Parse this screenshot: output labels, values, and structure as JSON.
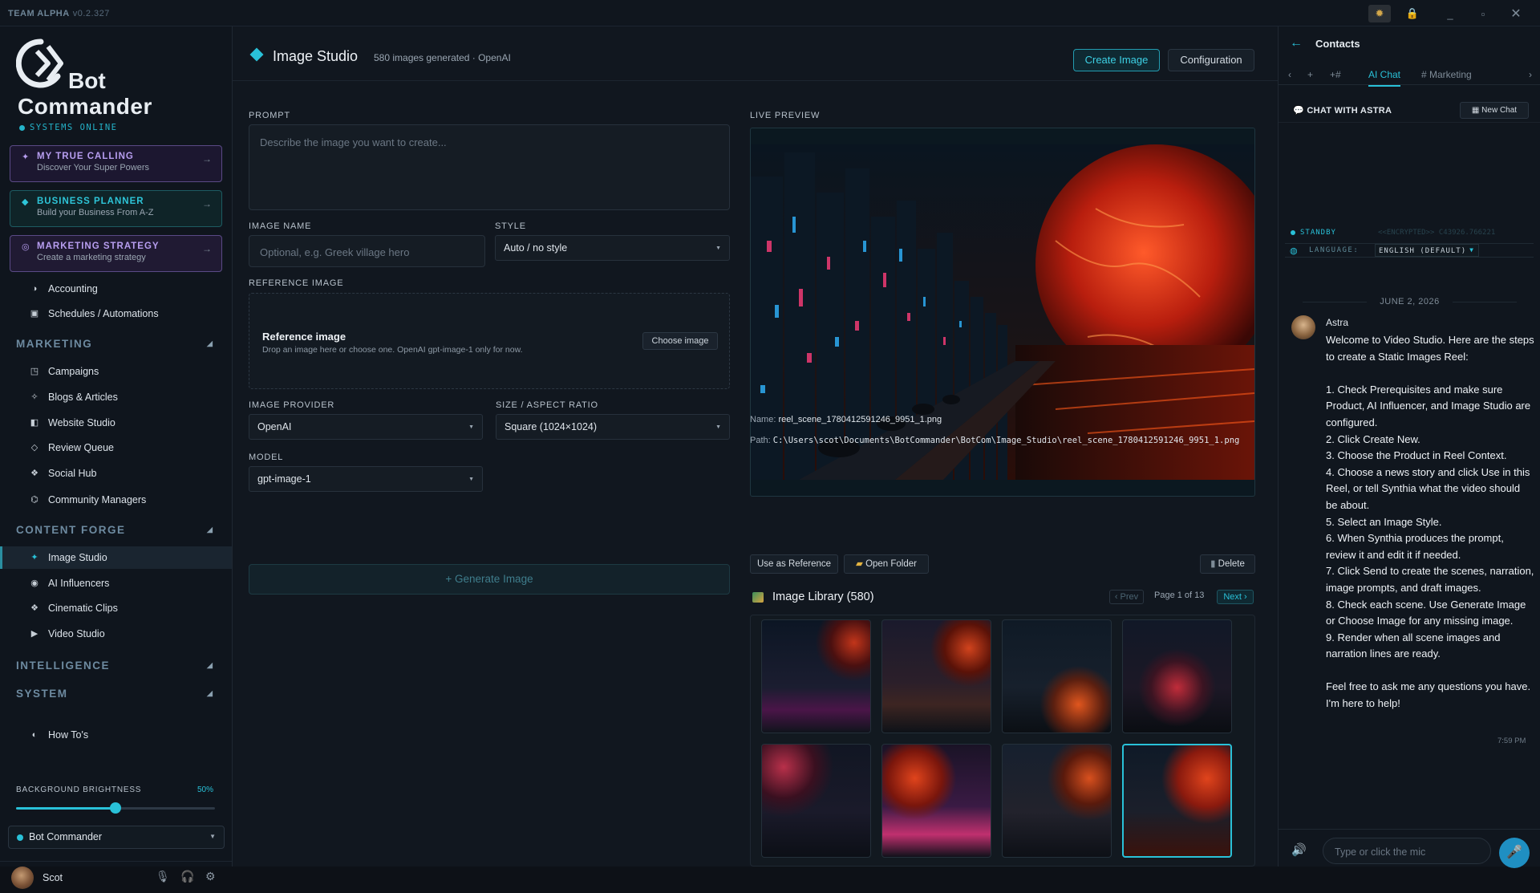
{
  "titlebar": {
    "app": "TEAM ALPHA",
    "version": "v0.2.327"
  },
  "brand": {
    "line1": "Bot",
    "line2": "Commander",
    "status": "SYSTEMS ONLINE"
  },
  "featured": [
    {
      "title": "MY TRUE CALLING",
      "subtitle": "Discover Your Super Powers",
      "icon": "sparkle-icon"
    },
    {
      "title": "BUSINESS PLANNER",
      "subtitle": "Build your Business From A-Z",
      "icon": "diamond-icon"
    },
    {
      "title": "MARKETING STRATEGY",
      "subtitle": "Create a marketing strategy",
      "icon": "target-icon"
    }
  ],
  "nav_top": [
    {
      "label": "Accounting"
    },
    {
      "label": "Schedules / Automations"
    }
  ],
  "sections": {
    "marketing": "MARKETING",
    "content_forge": "CONTENT FORGE",
    "intelligence": "INTELLIGENCE",
    "system": "SYSTEM"
  },
  "nav_marketing": [
    {
      "label": "Campaigns"
    },
    {
      "label": "Blogs & Articles"
    },
    {
      "label": "Website Studio"
    },
    {
      "label": "Review Queue"
    },
    {
      "label": "Social Hub"
    },
    {
      "label": "Community Managers"
    }
  ],
  "nav_content": [
    {
      "label": "Image Studio"
    },
    {
      "label": "AI Influencers"
    },
    {
      "label": "Cinematic Clips"
    },
    {
      "label": "Video Studio"
    }
  ],
  "nav_bottom": {
    "howtos": "How To's"
  },
  "brightness": {
    "label": "BACKGROUND BRIGHTNESS",
    "value": "50%",
    "fraction": 0.5
  },
  "agent": "Bot Commander",
  "user": {
    "name": "Scot"
  },
  "header": {
    "title": "Image Studio",
    "subtitle": "580 images generated · OpenAI",
    "create": "Create Image",
    "config": "Configuration"
  },
  "form": {
    "prompt_label": "PROMPT",
    "prompt_placeholder": "Describe the image you want to create...",
    "name_label": "IMAGE NAME",
    "name_placeholder": "Optional, e.g. Greek village hero",
    "style_label": "STYLE",
    "style_value": "Auto / no style",
    "ref_label": "REFERENCE IMAGE",
    "ref_title": "Reference image",
    "ref_sub": "Drop an image here or choose one. OpenAI gpt-image-1 only for now.",
    "ref_button": "Choose image",
    "provider_label": "IMAGE PROVIDER",
    "provider_value": "OpenAI",
    "size_label": "SIZE / ASPECT RATIO",
    "size_value": "Square (1024×1024)",
    "model_label": "MODEL",
    "model_value": "gpt-image-1",
    "generate": "+ Generate Image"
  },
  "preview": {
    "label": "LIVE PREVIEW",
    "name_label": "Name:",
    "name": "reel_scene_1780412591246_9951_1.png",
    "path_label": "Path:",
    "path": "C:\\Users\\scot\\Documents\\BotCommander\\BotCom\\Image_Studio\\reel_scene_1780412591246_9951_1.png",
    "use_ref": "Use as Reference",
    "open_folder": "Open Folder",
    "delete": "Delete"
  },
  "library": {
    "title": "Image Library (580)",
    "prev": "‹ Prev",
    "page": "Page 1 of 13",
    "next": "Next ›"
  },
  "contacts": {
    "title": "Contacts",
    "tabs": [
      "AI Chat",
      "# Marketing"
    ],
    "chat_title": "CHAT WITH ASTRA",
    "new_chat": "New Chat",
    "status": "STANDBY",
    "encrypted": "<<ENCRYPTED>> C43926.766221",
    "language_label": "LANGUAGE:",
    "language": "ENGLISH (DEFAULT)",
    "date": "JUNE 2, 2026",
    "sender": "Astra",
    "message": "Welcome to Video Studio. Here are the steps to create a Static Images Reel:\n\n1. Check Prerequisites and make sure Product, AI Influencer, and Image Studio are configured.\n2. Click Create New.\n3. Choose the Product in Reel Context.\n4. Choose a news story and click Use in this Reel, or tell Synthia what the video should be about.\n5. Select an Image Style.\n6. When Synthia produces the prompt, review it and edit it if needed.\n7. Click Send to create the scenes, narration, image prompts, and draft images.\n8. Check each scene. Use Generate Image or Choose Image for any missing image.\n9. Render when all scene images and narration lines are ready.\n\nFeel free to ask me any questions you have. I'm here to help!",
    "time": "7:59 PM",
    "input_placeholder": "Type or click the mic"
  }
}
